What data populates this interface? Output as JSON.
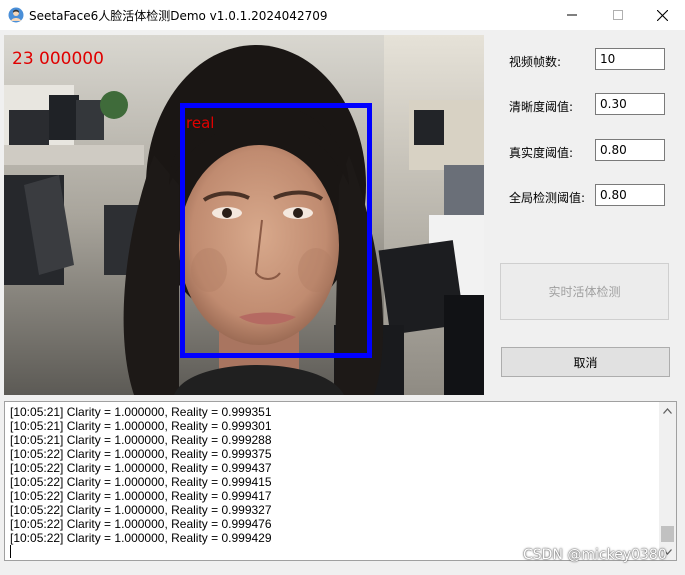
{
  "window": {
    "title": "SeetaFace6人脸活体检测Demo v1.0.1.2024042709"
  },
  "video": {
    "fps_overlay": "23 000000",
    "face_label": "real"
  },
  "params": [
    {
      "label": "视频帧数:",
      "value": "10"
    },
    {
      "label": "清晰度阈值:",
      "value": "0.30"
    },
    {
      "label": "真实度阈值:",
      "value": "0.80"
    },
    {
      "label": "全局检测阈值:",
      "value": "0.80"
    }
  ],
  "buttons": {
    "realtime_detect": "实时活体检测",
    "cancel": "取消"
  },
  "log": {
    "lines": [
      "[10:05:21] Clarity = 1.000000, Reality = 0.999351",
      "[10:05:21] Clarity = 1.000000, Reality = 0.999301",
      "[10:05:21] Clarity = 1.000000, Reality = 0.999288",
      "[10:05:22] Clarity = 1.000000, Reality = 0.999375",
      "[10:05:22] Clarity = 1.000000, Reality = 0.999437",
      "[10:05:22] Clarity = 1.000000, Reality = 0.999415",
      "[10:05:22] Clarity = 1.000000, Reality = 0.999417",
      "[10:05:22] Clarity = 1.000000, Reality = 0.999327",
      "[10:05:22] Clarity = 1.000000, Reality = 0.999476",
      "[10:05:22] Clarity = 1.000000, Reality = 0.999429"
    ]
  },
  "watermark": "CSDN @mickey0380",
  "icons": {
    "app": "person-avatar-icon",
    "minimize": "minimize-icon",
    "maximize": "maximize-icon",
    "close": "close-icon",
    "scroll_up": "chevron-up-icon",
    "scroll_down": "chevron-down-icon"
  },
  "colors": {
    "face_box": "#0000ff",
    "overlay_text": "#e00000"
  }
}
